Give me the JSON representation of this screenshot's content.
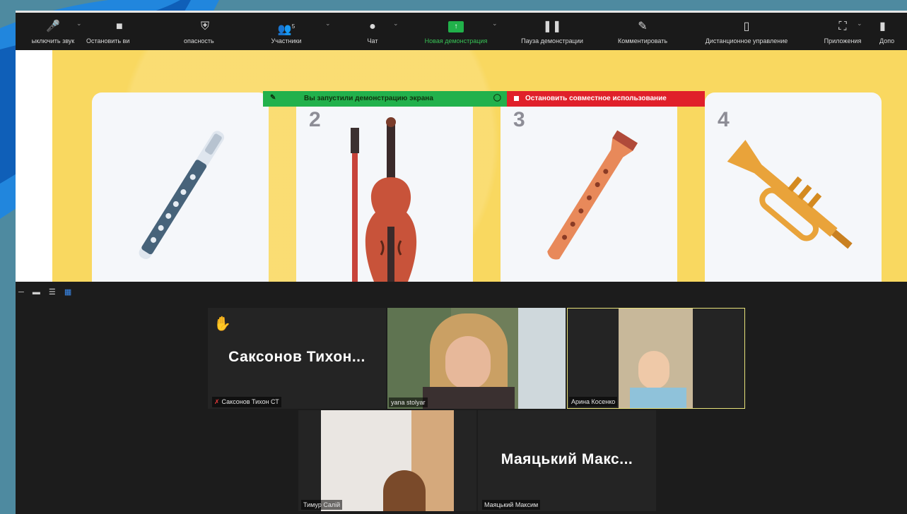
{
  "toolbar": {
    "items": [
      {
        "label": "ыключить звук",
        "icon": "microphone-icon"
      },
      {
        "label": "Остановить ви",
        "icon": "video-camera-icon"
      },
      {
        "label": "опасность",
        "icon": "shield-icon"
      },
      {
        "label": "Участники",
        "icon": "participants-icon",
        "count": "5"
      },
      {
        "label": "Чат",
        "icon": "chat-icon"
      },
      {
        "label": "Новая демонстрация",
        "icon": "new-share-icon"
      },
      {
        "label": "Пауза демонстрации",
        "icon": "pause-icon"
      },
      {
        "label": "Комментировать",
        "icon": "pencil-icon"
      },
      {
        "label": "Дистанционное управление",
        "icon": "mouse-icon"
      },
      {
        "label": "Приложения",
        "icon": "apps-icon"
      },
      {
        "label": "Допо",
        "icon": "more-icon"
      }
    ]
  },
  "share_banner": {
    "status": "Вы запустили демонстрацию экрана",
    "stop": "Остановить совместное использование"
  },
  "slide": {
    "cards": [
      {
        "number": "",
        "instrument": "flute-icon"
      },
      {
        "number": "2",
        "instrument": "violin-icon"
      },
      {
        "number": "3",
        "instrument": "recorder-icon"
      },
      {
        "number": "4",
        "instrument": "trumpet-icon"
      }
    ]
  },
  "gallery": {
    "participants": [
      {
        "display_name": "Саксонов Тихон...",
        "tag": "Саксонов Тихон СТ",
        "muted": true,
        "raised_hand": true
      },
      {
        "tag": "yana stolyar"
      },
      {
        "tag": "Арина Косенко",
        "active": true
      },
      {
        "tag": "Тимур Салій"
      },
      {
        "display_name": "Маяцький Макс...",
        "tag": "Маяцький Максим"
      }
    ]
  },
  "colors": {
    "accent_green": "#22b14c",
    "stop_red": "#e0202a",
    "slide_yellow": "#f9d860",
    "active_border": "#e8e27a"
  }
}
